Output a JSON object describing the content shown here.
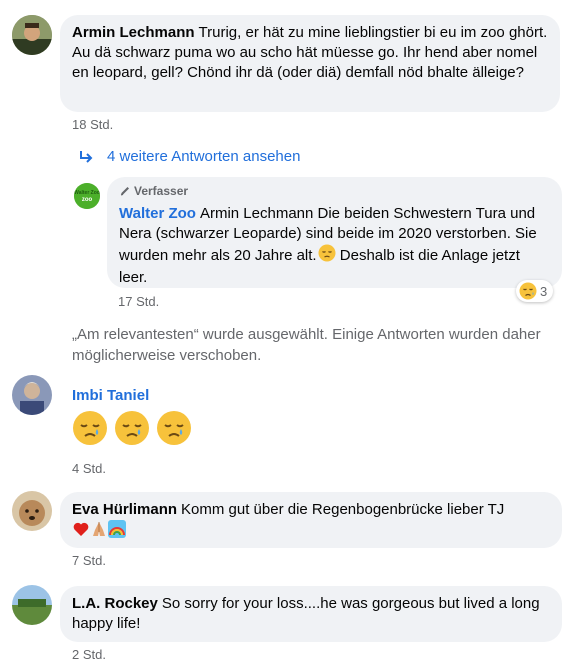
{
  "comments": [
    {
      "author": "Armin Lechmann",
      "text": "Trurig, er hät zu mine lieblingstier bi eu im zoo ghört. Au dä schwarz puma wo au scho hät müesse go. Ihr hend aber nomel en leopard, gell? Chönd ihr dä (oder diä) demfall nöd bhalte älleige?",
      "time": "18 Std."
    },
    {
      "author": "Imbi Taniel",
      "text": "",
      "time": "4 Std."
    },
    {
      "author": "Eva Hürlimann",
      "text": "Komm gut über die Regenbogenbrücke lieber TJ",
      "time": "7 Std."
    },
    {
      "author": "L.A. Rockey",
      "text": "So sorry for your loss....he was gorgeous but lived a long happy life!",
      "time": "2 Std."
    }
  ],
  "replies_link": "4 weitere Antworten ansehen",
  "reply": {
    "badge": "Verfasser",
    "author": "Walter Zoo",
    "text": "Armin Lechmann Die beiden Schwestern Tura und Nera (schwarzer Leoparde) sind beide im 2020 verstorben. Sie wurden mehr als 20 Jahre alt.",
    "text_after": " Deshalb ist die Anlage jetzt leer.",
    "time": "17 Std.",
    "reaction_count": "3",
    "avatar_text": "Walter Zoo"
  },
  "sort_note": "„Am relevantesten“ wurde ausgewählt. Einige Antworten wurden daher möglicherweise verschoben.",
  "colors": {
    "link_blue": "#216fdb",
    "bubble_bg": "#f0f2f5",
    "meta_gray": "#65676b",
    "zoo_green": "#4caf2a"
  },
  "icons": [
    "reply-arrow-icon",
    "pencil-icon",
    "sad-relieved-face-icon",
    "heart-icon",
    "folded-hands-icon",
    "rainbow-icon"
  ]
}
